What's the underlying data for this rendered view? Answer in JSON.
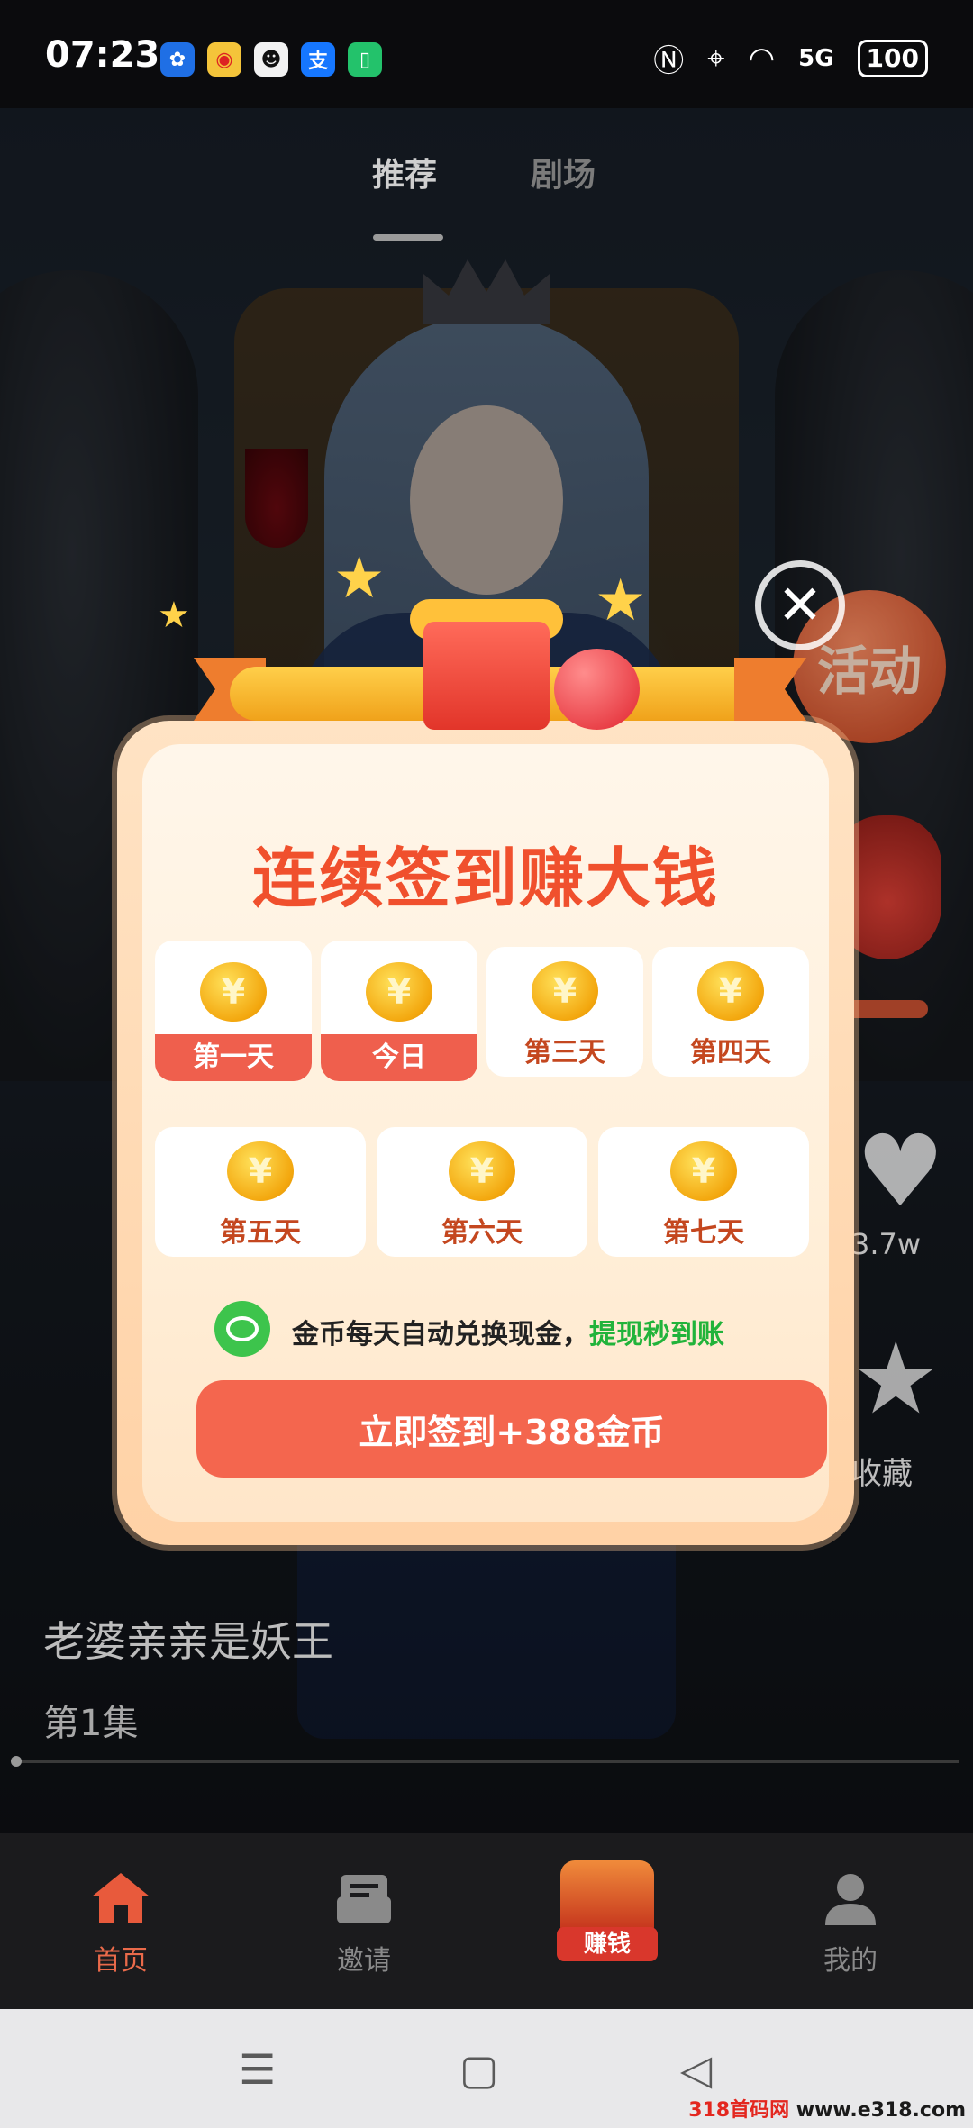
{
  "status_bar": {
    "time": "07:23",
    "battery": "100",
    "signal_label": "5G"
  },
  "header_tabs": [
    {
      "label": "推荐",
      "active": true
    },
    {
      "label": "剧场",
      "active": false
    }
  ],
  "side_actions": {
    "activity_label": "活动",
    "like_count": "3.7w",
    "favorite_label": "收藏"
  },
  "drama": {
    "title": "老婆亲亲是妖王",
    "episode": "第1集"
  },
  "modal": {
    "title": "连续签到赚大钱",
    "coin_symbol": "¥",
    "days": [
      {
        "label": "第一天",
        "signed": true
      },
      {
        "label": "今日",
        "signed": true
      },
      {
        "label": "第三天",
        "signed": false
      },
      {
        "label": "第四天",
        "signed": false
      },
      {
        "label": "第五天",
        "signed": false
      },
      {
        "label": "第六天",
        "signed": false
      },
      {
        "label": "第七天",
        "signed": false
      }
    ],
    "hint_text": "金币每天自动兑换现金，",
    "hint_highlight": "提现秒到账",
    "button_label": "立即签到+388金币",
    "close_icon": "close-icon"
  },
  "bottom_nav": [
    {
      "label": "首页",
      "icon": "home-icon",
      "active": true
    },
    {
      "label": "邀请",
      "icon": "invite-icon",
      "active": false
    },
    {
      "label": "赚钱",
      "icon": "gift-icon",
      "active": false
    },
    {
      "label": "我的",
      "icon": "profile-icon",
      "active": false
    }
  ],
  "watermark": {
    "red": "318首码网",
    "black": " www.e318.com"
  },
  "colors": {
    "accent": "#f4664e",
    "title": "#f0502d",
    "highlight_green": "#21b33a",
    "home_active": "#ea6a4a"
  }
}
